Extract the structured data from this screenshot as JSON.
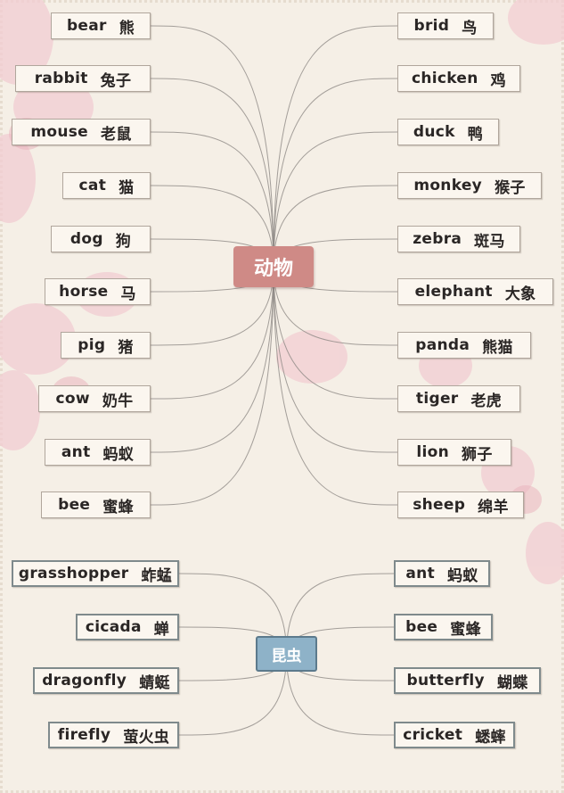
{
  "animals": {
    "center_label": "动物",
    "left": [
      {
        "en": "bear",
        "zh": "熊"
      },
      {
        "en": "rabbit",
        "zh": "兔子"
      },
      {
        "en": "mouse",
        "zh": "老鼠"
      },
      {
        "en": "cat",
        "zh": "猫"
      },
      {
        "en": "dog",
        "zh": "狗"
      },
      {
        "en": "horse",
        "zh": "马"
      },
      {
        "en": "pig",
        "zh": "猪"
      },
      {
        "en": "cow",
        "zh": "奶牛"
      },
      {
        "en": "ant",
        "zh": "蚂蚁"
      },
      {
        "en": "bee",
        "zh": "蜜蜂"
      }
    ],
    "right": [
      {
        "en": "brid",
        "zh": "鸟"
      },
      {
        "en": "chicken",
        "zh": "鸡"
      },
      {
        "en": "duck",
        "zh": "鸭"
      },
      {
        "en": "monkey",
        "zh": "猴子"
      },
      {
        "en": "zebra",
        "zh": "斑马"
      },
      {
        "en": "elephant",
        "zh": "大象"
      },
      {
        "en": "panda",
        "zh": "熊猫"
      },
      {
        "en": "tiger",
        "zh": "老虎"
      },
      {
        "en": "lion",
        "zh": "狮子"
      },
      {
        "en": "sheep",
        "zh": "绵羊"
      }
    ]
  },
  "insects": {
    "center_label": "昆虫",
    "left": [
      {
        "en": "grasshopper",
        "zh": "蚱蜢"
      },
      {
        "en": "cicada",
        "zh": "蝉"
      },
      {
        "en": "dragonfly",
        "zh": "蜻蜓"
      },
      {
        "en": "firefly",
        "zh": "萤火虫"
      }
    ],
    "right": [
      {
        "en": "ant",
        "zh": "蚂蚁"
      },
      {
        "en": "bee",
        "zh": "蜜蜂"
      },
      {
        "en": "butterfly",
        "zh": "蝴蝶"
      },
      {
        "en": "cricket",
        "zh": "蟋蟀"
      }
    ]
  },
  "colors": {
    "background": "#f5efe6",
    "animals_center": "#cf8a86",
    "insects_center": "#8eb2c8",
    "connector": "#8f8a86",
    "blossom": "#f2c9cf"
  }
}
